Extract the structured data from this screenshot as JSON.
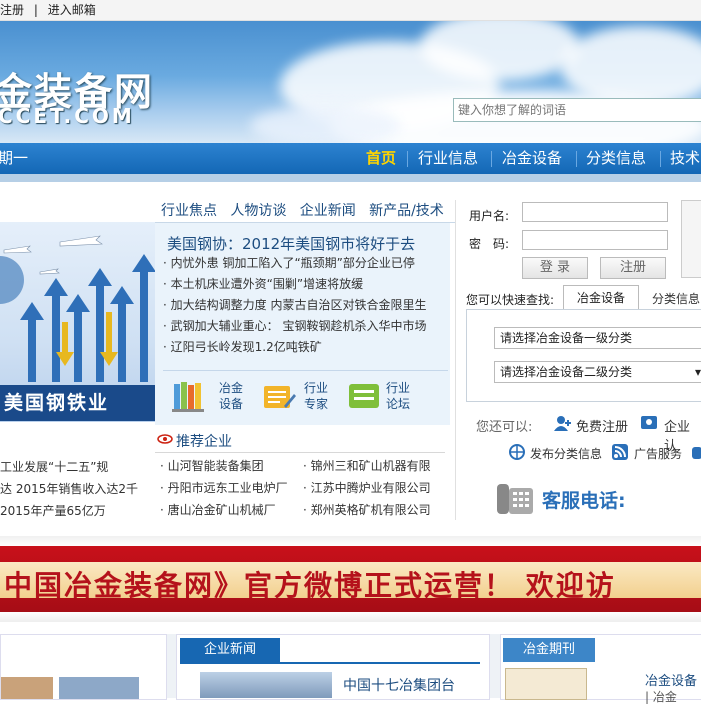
{
  "topbar": {
    "register": "注册",
    "separator": "|",
    "mailbox": "进入邮箱"
  },
  "header": {
    "logo_cn": "金装备网",
    "logo_en": "CCET.COM",
    "search_placeholder": "键入你想了解的词语"
  },
  "nav": {
    "left_text": "期一",
    "items": [
      "首页",
      "行业信息",
      "冶金设备",
      "分类信息",
      "技术"
    ]
  },
  "news": {
    "tabs": [
      "行业焦点",
      "人物访谈",
      "企业新闻",
      "新产品/技术"
    ],
    "headline": "美国钢协：2012年美国钢市将好于去",
    "items": [
      "内忧外患 铜加工陷入了“瓶颈期”部分企业已停",
      "本土机床业遭外资“围剿”增速将放缓",
      "加大结构调整力度 内蒙古自治区对铁合金限里生",
      "武钢加大辅业重心： 宝钢鞍钢趁机杀入华中市场",
      "辽阳弓长岭发现1.2亿吨铁矿"
    ],
    "banner_title": "美国钢铁业"
  },
  "shortcuts": [
    {
      "icon": "books-icon",
      "line1": "冶金",
      "line2": "设备"
    },
    {
      "icon": "expert-icon",
      "line1": "行业",
      "line2": "专家"
    },
    {
      "icon": "forum-icon",
      "line1": "行业",
      "line2": "论坛"
    }
  ],
  "left_lower": [
    "工业发展“十二五”规",
    "达 2015年销售收入达2千",
    "2015年产量65亿万"
  ],
  "recommend": {
    "title": "推荐企业",
    "left": [
      "山河智能装备集团",
      "丹阳市远东工业电炉厂",
      "唐山冶金矿山机械厂"
    ],
    "right": [
      "锦州三和矿山机器有限",
      "江苏中腾炉业有限公司",
      "郑州英格矿机有限公司"
    ]
  },
  "login": {
    "username_label": "用户名:",
    "password_label": "密　码:",
    "login_button": "登 录",
    "register_button": "注册",
    "quick_search_label": "您可以快速查找:",
    "quick_tabs": [
      "冶金设备",
      "分类信息"
    ],
    "select1": "请选择冶金设备一级分类",
    "select2": "请选择冶金设备二级分类"
  },
  "services": {
    "label": "您还可以:",
    "free_register": "免费注册",
    "enterprise_auth": "企业认",
    "post_info": "发布分类信息",
    "ad_service": "广告服务",
    "hotline": "客服电话:"
  },
  "promo": {
    "text": "中国冶金装备网》官方微博正式运营！ 欢迎访"
  },
  "bottom": {
    "enterprise_news_title": "企业新闻",
    "enterprise_news_item": "中国十七冶集团台",
    "journal_title": "冶金期刊",
    "journal_item": "冶金设备",
    "journal_sub": "| 冶金"
  },
  "colors": {
    "nav_blue": "#1a6dbd",
    "active_nav": "#ffd400",
    "promo_red": "#b5121b"
  }
}
